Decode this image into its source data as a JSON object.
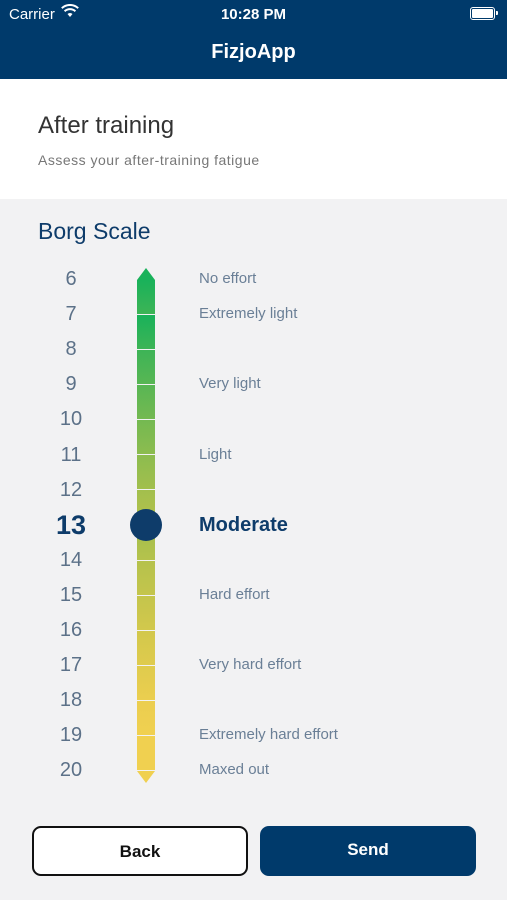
{
  "status_bar": {
    "carrier": "Carrier",
    "time": "10:28 PM"
  },
  "nav": {
    "title": "FizjoApp"
  },
  "header": {
    "title": "After training",
    "subtitle": "Assess your after-training fatigue"
  },
  "scale": {
    "title": "Borg Scale",
    "selected_value": 13,
    "levels": [
      {
        "value": "6",
        "label": "No effort"
      },
      {
        "value": "7",
        "label": "Extremely light"
      },
      {
        "value": "8",
        "label": ""
      },
      {
        "value": "9",
        "label": "Very light"
      },
      {
        "value": "10",
        "label": ""
      },
      {
        "value": "11",
        "label": "Light"
      },
      {
        "value": "12",
        "label": ""
      },
      {
        "value": "13",
        "label": "Moderate"
      },
      {
        "value": "14",
        "label": ""
      },
      {
        "value": "15",
        "label": "Hard effort"
      },
      {
        "value": "16",
        "label": ""
      },
      {
        "value": "17",
        "label": "Very hard effort"
      },
      {
        "value": "18",
        "label": ""
      },
      {
        "value": "19",
        "label": "Extremely hard effort"
      },
      {
        "value": "20",
        "label": "Maxed out"
      }
    ],
    "gradient_colors": [
      "#19b25a",
      "#3db456",
      "#58b654",
      "#74b951",
      "#8cbc4f",
      "#a2bf4d",
      "#b5c24c",
      "#c4c54c",
      "#d2c84c",
      "#dfcb4d",
      "#ebce4f",
      "#f0d050"
    ],
    "knob_color": "#0e3c6a"
  },
  "actions": {
    "back_label": "Back",
    "send_label": "Send"
  }
}
